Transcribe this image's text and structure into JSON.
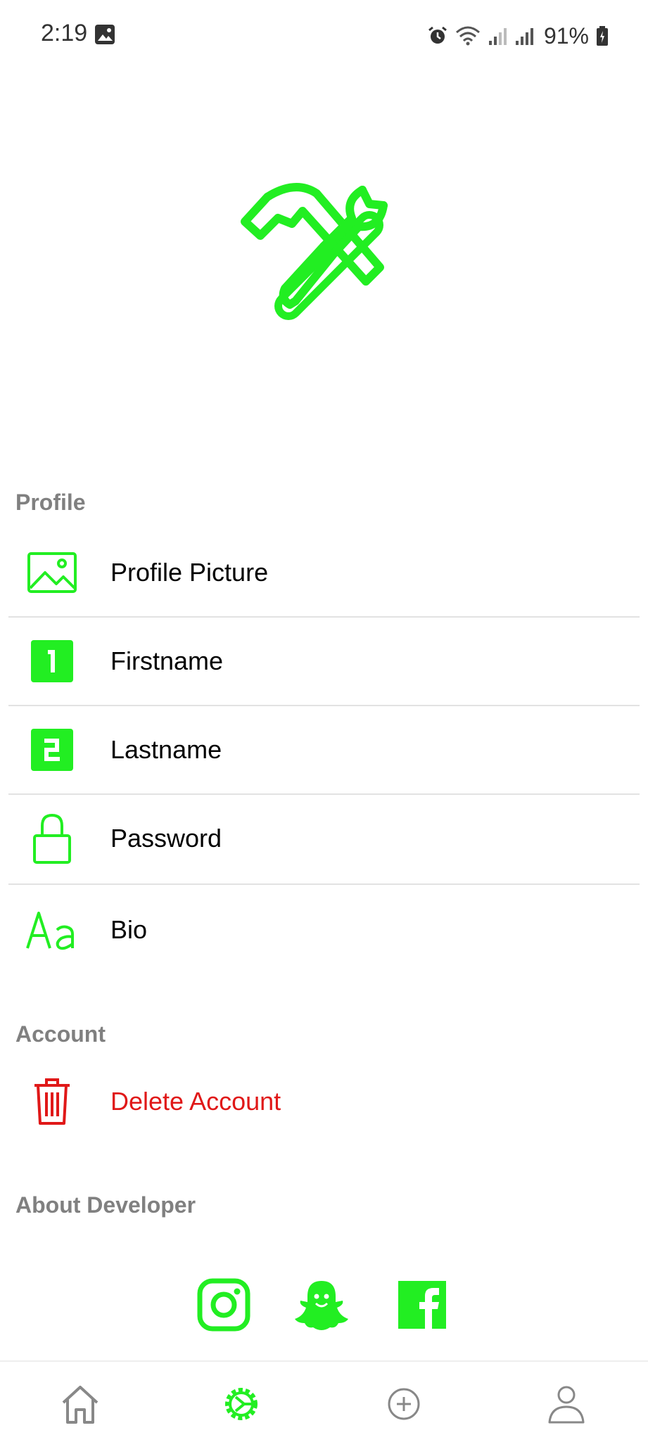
{
  "status": {
    "time": "2:19",
    "battery": "91%"
  },
  "colors": {
    "accent": "#22ee22",
    "danger": "#e01818",
    "header": "#808080"
  },
  "sections": {
    "profile": {
      "title": "Profile",
      "items": [
        {
          "label": "Profile Picture",
          "icon": "image-icon"
        },
        {
          "label": "Firstname",
          "icon": "number-1-icon"
        },
        {
          "label": "Lastname",
          "icon": "number-2-icon"
        },
        {
          "label": "Password",
          "icon": "lock-icon"
        },
        {
          "label": "Bio",
          "icon": "text-icon"
        }
      ]
    },
    "account": {
      "title": "Account",
      "delete_label": "Delete Account"
    },
    "about": {
      "title": "About Developer"
    }
  },
  "social": [
    "instagram-icon",
    "snapchat-icon",
    "facebook-icon"
  ],
  "nav": [
    "home-icon",
    "settings-icon",
    "add-icon",
    "profile-icon"
  ],
  "active_nav": "settings-icon"
}
